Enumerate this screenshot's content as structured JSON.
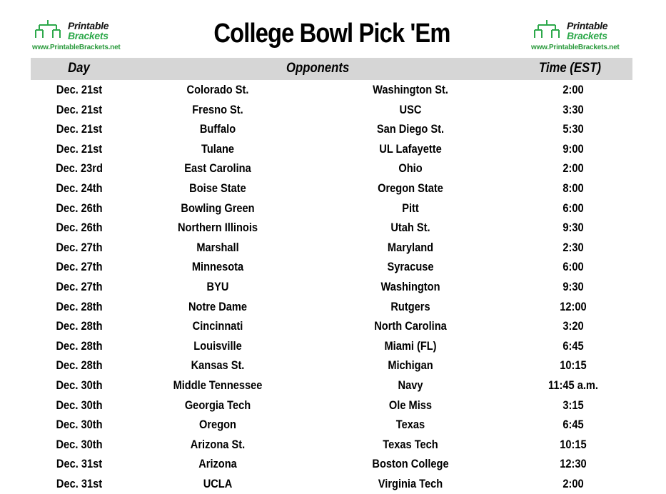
{
  "title": "College Bowl Pick 'Em",
  "logos": {
    "brand_line1": "Printable",
    "brand_line2": "Brackets",
    "url": "www.PrintableBrackets.net",
    "icon": "bracket-icon",
    "colors": {
      "brand_dark": "#111111",
      "brand_green": "#2ca84a"
    }
  },
  "table": {
    "headers": {
      "day": "Day",
      "opponents": "Opponents",
      "time": "Time (EST)"
    },
    "header_bg": "#d6d6d6",
    "rows": [
      {
        "day": "Dec. 21st",
        "team1": "Colorado St.",
        "team2": "Washington St.",
        "time": "2:00"
      },
      {
        "day": "Dec. 21st",
        "team1": "Fresno St.",
        "team2": "USC",
        "time": "3:30"
      },
      {
        "day": "Dec. 21st",
        "team1": "Buffalo",
        "team2": "San Diego St.",
        "time": "5:30"
      },
      {
        "day": "Dec. 21st",
        "team1": "Tulane",
        "team2": "UL Lafayette",
        "time": "9:00"
      },
      {
        "day": "Dec. 23rd",
        "team1": "East Carolina",
        "team2": "Ohio",
        "time": "2:00"
      },
      {
        "day": "Dec. 24th",
        "team1": "Boise State",
        "team2": "Oregon State",
        "time": "8:00"
      },
      {
        "day": "Dec. 26th",
        "team1": "Bowling Green",
        "team2": "Pitt",
        "time": "6:00"
      },
      {
        "day": "Dec. 26th",
        "team1": "Northern Illinois",
        "team2": "Utah St.",
        "time": "9:30"
      },
      {
        "day": "Dec. 27th",
        "team1": "Marshall",
        "team2": "Maryland",
        "time": "2:30"
      },
      {
        "day": "Dec. 27th",
        "team1": "Minnesota",
        "team2": "Syracuse",
        "time": "6:00"
      },
      {
        "day": "Dec. 27th",
        "team1": "BYU",
        "team2": "Washington",
        "time": "9:30"
      },
      {
        "day": "Dec. 28th",
        "team1": "Notre Dame",
        "team2": "Rutgers",
        "time": "12:00"
      },
      {
        "day": "Dec. 28th",
        "team1": "Cincinnati",
        "team2": "North Carolina",
        "time": "3:20"
      },
      {
        "day": "Dec. 28th",
        "team1": "Louisville",
        "team2": "Miami (FL)",
        "time": "6:45"
      },
      {
        "day": "Dec. 28th",
        "team1": "Kansas St.",
        "team2": "Michigan",
        "time": "10:15"
      },
      {
        "day": "Dec. 30th",
        "team1": "Middle Tennessee",
        "team2": "Navy",
        "time": "11:45 a.m."
      },
      {
        "day": "Dec. 30th",
        "team1": "Georgia Tech",
        "team2": "Ole Miss",
        "time": "3:15"
      },
      {
        "day": "Dec. 30th",
        "team1": "Oregon",
        "team2": "Texas",
        "time": "6:45"
      },
      {
        "day": "Dec. 30th",
        "team1": "Arizona St.",
        "team2": "Texas Tech",
        "time": "10:15"
      },
      {
        "day": "Dec. 31st",
        "team1": "Arizona",
        "team2": "Boston College",
        "time": "12:30"
      },
      {
        "day": "Dec. 31st",
        "team1": "UCLA",
        "team2": "Virginia Tech",
        "time": "2:00"
      }
    ]
  }
}
